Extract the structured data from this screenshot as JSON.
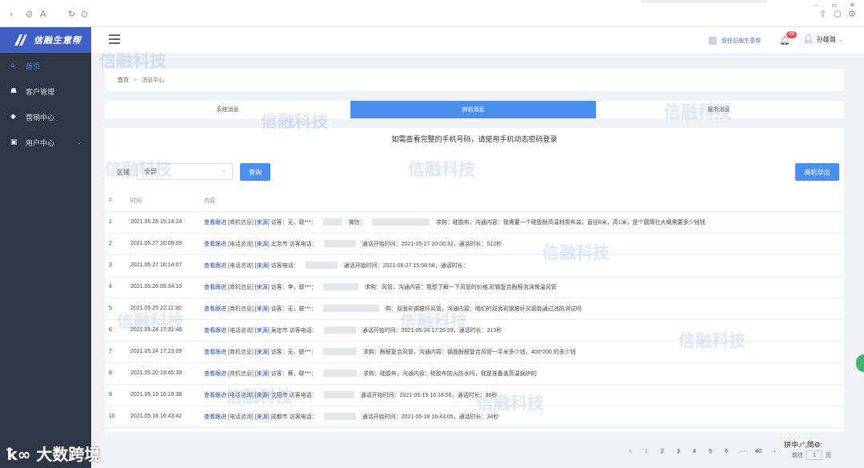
{
  "sidebar": {
    "logo": "信融生意帮",
    "items": [
      {
        "label": "首页",
        "icon": "home-icon"
      },
      {
        "label": "客户管理",
        "icon": "users-icon"
      },
      {
        "label": "营销中心",
        "icon": "gift-icon"
      },
      {
        "label": "用户中心",
        "icon": "user-card-icon"
      }
    ]
  },
  "header": {
    "old_version_link": "前往旧版生意帮",
    "notification_count": "99",
    "user_name": "孙雄璐"
  },
  "breadcrumb": {
    "home": "首页",
    "separator": ">",
    "current": "消息中心"
  },
  "tabs": [
    "系统消息",
    "商机消息",
    "服务消息"
  ],
  "notice": "如需查看完整的手机号码，请使用手机动态密码登录",
  "filter": {
    "label": "区域",
    "value": "全部",
    "query_button": "查询",
    "export_button": "商机导出"
  },
  "table": {
    "headers": [
      "#",
      "时间",
      "内容"
    ],
    "rows": [
      {
        "idx": "1",
        "time": "2021.05.28 15:14:24",
        "link": "查看跟进",
        "tag": "[商机信息]",
        "src": "[来源]",
        "text": "访客：无，联***：",
        "text2": "微信：",
        "text3": "求购：硅胶布，沟通内容：我需要一个硅胶耐高温材质布袋，直径8米，高1米，是个圆筒壮大概需要多少钱钱"
      },
      {
        "idx": "2",
        "time": "2021.05.27 20:09:09",
        "link": "查看跟进",
        "tag": "[电话咨询]",
        "src": "[来源]",
        "text": "北京市 访客电话：",
        "text2": "",
        "text3": "通话开始时间：2021-05-27 20:00:32，通话时长：512秒"
      },
      {
        "idx": "3",
        "time": "2021.05.27 16:14:07",
        "link": "查看跟进",
        "tag": "[电话咨询]",
        "src": "[来源]",
        "text": "访客电话：",
        "text2": "",
        "text3": "通话开始时间：2021-05-27 15:58:58，通话时长："
      },
      {
        "idx": "4",
        "time": "2021.05.26 09:34:10",
        "link": "查看跟进",
        "tag": "[商机信息]",
        "src": "[来源]",
        "text": "访客：李，联***：",
        "text2": "",
        "text3": "求购：风管，沟通内容：我想了解一下风管的价格,彩钢复合酚醛泡沫保温风管"
      },
      {
        "idx": "5",
        "time": "2021.05.25 22:11:30",
        "link": "查看跟进",
        "tag": "[商机信息]",
        "src": "[来源]",
        "text": "访客：无，联***：",
        "text2": "",
        "text3": "购：双面彩钢玻纤风管，沟通内容：咱们的双面彩钢玻纤风管能通过消防测试吗"
      },
      {
        "idx": "6",
        "time": "2021.05.24 17:31:46",
        "link": "查看跟进",
        "tag": "[电话咨询]",
        "src": "[来源]",
        "text": "吴忠市 访客电话：",
        "text2": "",
        "text3": "通话开始时间：2021-05-24 17:26:29，通话时长：313秒"
      },
      {
        "idx": "7",
        "time": "2021.05.24 17:23:09",
        "link": "查看跟进",
        "tag": "[商机信息]",
        "src": "[来源]",
        "text": "访客：无，联***：",
        "text2": "",
        "text3": "求购：酚醛复合风管，沟通内容：钢面酚醛复合风管一平米多少钱，400*200 的多少钱"
      },
      {
        "idx": "8",
        "time": "2021.05.20 19:45:39",
        "link": "查看跟进",
        "tag": "[商机信息]",
        "src": "[来源]",
        "text": "访客：蔡，联***：",
        "text2": "",
        "text3": "求购：硅胶布，沟通内容：硅胶布防火防水吗，我是准备盖高温锅炉的"
      },
      {
        "idx": "9",
        "time": "2021.05.19 16:19:38",
        "link": "查看跟进",
        "tag": "[电话咨询]",
        "src": "[来源]",
        "text": "沈阳市 访客电话：",
        "text2": "",
        "text3": "通话开始时间：2021-05-19 16:18:56，通话时长：36秒"
      },
      {
        "idx": "10",
        "time": "2021.05.18 16:43:42",
        "link": "查看跟进",
        "tag": "[电话咨询]",
        "src": "[来源]",
        "text": "成都市 访客电话：",
        "text2": "",
        "text3": "通话开始时间：2021-05-18 16:43:05，通话时长：34秒"
      }
    ]
  },
  "pager": {
    "prev": "‹",
    "pages": [
      "1",
      "2",
      "3",
      "4",
      "5",
      "6",
      "···",
      "40"
    ],
    "next": "›",
    "goto_label": "前往",
    "goto_value": "1",
    "goto_unit": "页"
  },
  "ime_bar": "拼中♪°,简⚙:",
  "watermark": "信融科技",
  "brand_mark": "大数跨境",
  "colors": {
    "sidebar_bg": "#2f3746",
    "accent": "#4a90f0",
    "logo_bg": "#3f5fc6"
  }
}
